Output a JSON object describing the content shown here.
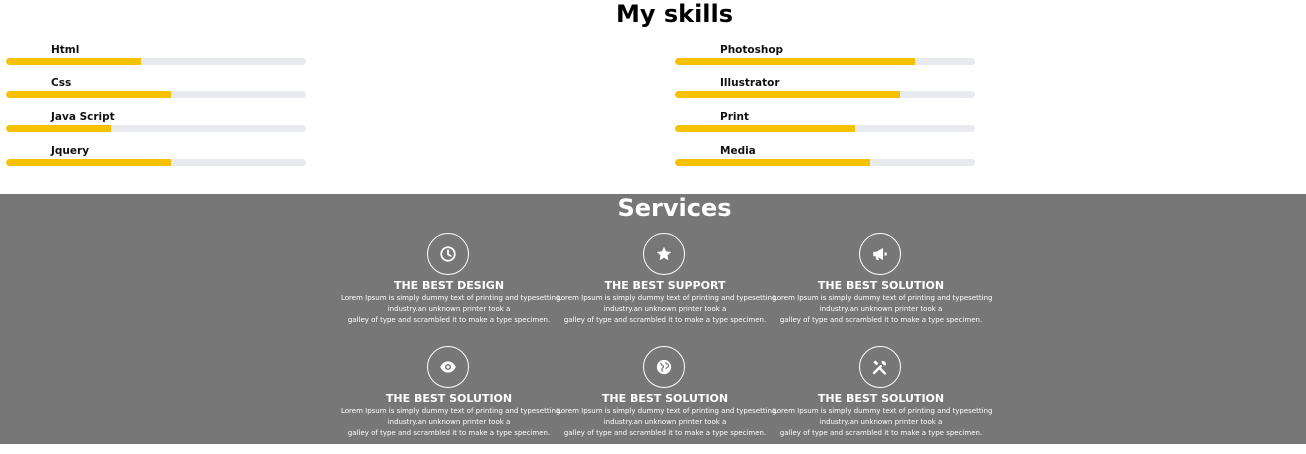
{
  "skills": {
    "title": "My skills",
    "items": [
      {
        "label": "Html",
        "percent": 45
      },
      {
        "label": "Css",
        "percent": 55
      },
      {
        "label": "Java Script",
        "percent": 35
      },
      {
        "label": "Jquery",
        "percent": 55
      },
      {
        "label": "Photoshop",
        "percent": 80
      },
      {
        "label": "Illustrator",
        "percent": 75
      },
      {
        "label": "Print",
        "percent": 60
      },
      {
        "label": "Media",
        "percent": 65
      }
    ]
  },
  "services": {
    "title": "Services",
    "items": [
      {
        "icon": "clock-icon",
        "title": "THE BEST DESIGN",
        "text": [
          "Lorem Ipsum is simply dummy text of printing and typesetting",
          "industry.an unknown printer took a",
          "galley of type and scrambled it to make a type specimen."
        ]
      },
      {
        "icon": "star-icon",
        "title": "THE BEST SUPPORT",
        "text": [
          "Lorem Ipsum is simply dummy text of printing and typesetting",
          "industry.an unknown printer took a",
          "galley of type and scrambled it to make a type specimen."
        ]
      },
      {
        "icon": "megaphone-icon",
        "title": "THE BEST SOLUTION",
        "text": [
          "Lorem Ipsum is simply dummy text of printing and typesetting",
          "industry.an unknown printer took a",
          "galley of type and scrambled it to make a type specimen."
        ]
      },
      {
        "icon": "eye-icon",
        "title": "THE BEST SOLUTION",
        "text": [
          "Lorem Ipsum is simply dummy text of printing and typesetting",
          "industry.an unknown printer took a",
          "galley of type and scrambled it to make a type specimen."
        ]
      },
      {
        "icon": "globe-icon",
        "title": "THE BEST SOLUTION",
        "text": [
          "Lorem Ipsum is simply dummy text of printing and typesetting",
          "industry.an unknown printer took a",
          "galley of type and scrambled it to make a type specimen."
        ]
      },
      {
        "icon": "tools-icon",
        "title": "THE BEST SOLUTION",
        "text": [
          "Lorem Ipsum is simply dummy text of printing and typesetting",
          "industry.an unknown printer took a",
          "galley of type and scrambled it to make a type specimen."
        ]
      }
    ]
  },
  "colors": {
    "accent": "#f5c100",
    "track": "#e8eaed",
    "services_bg": "#777777"
  }
}
